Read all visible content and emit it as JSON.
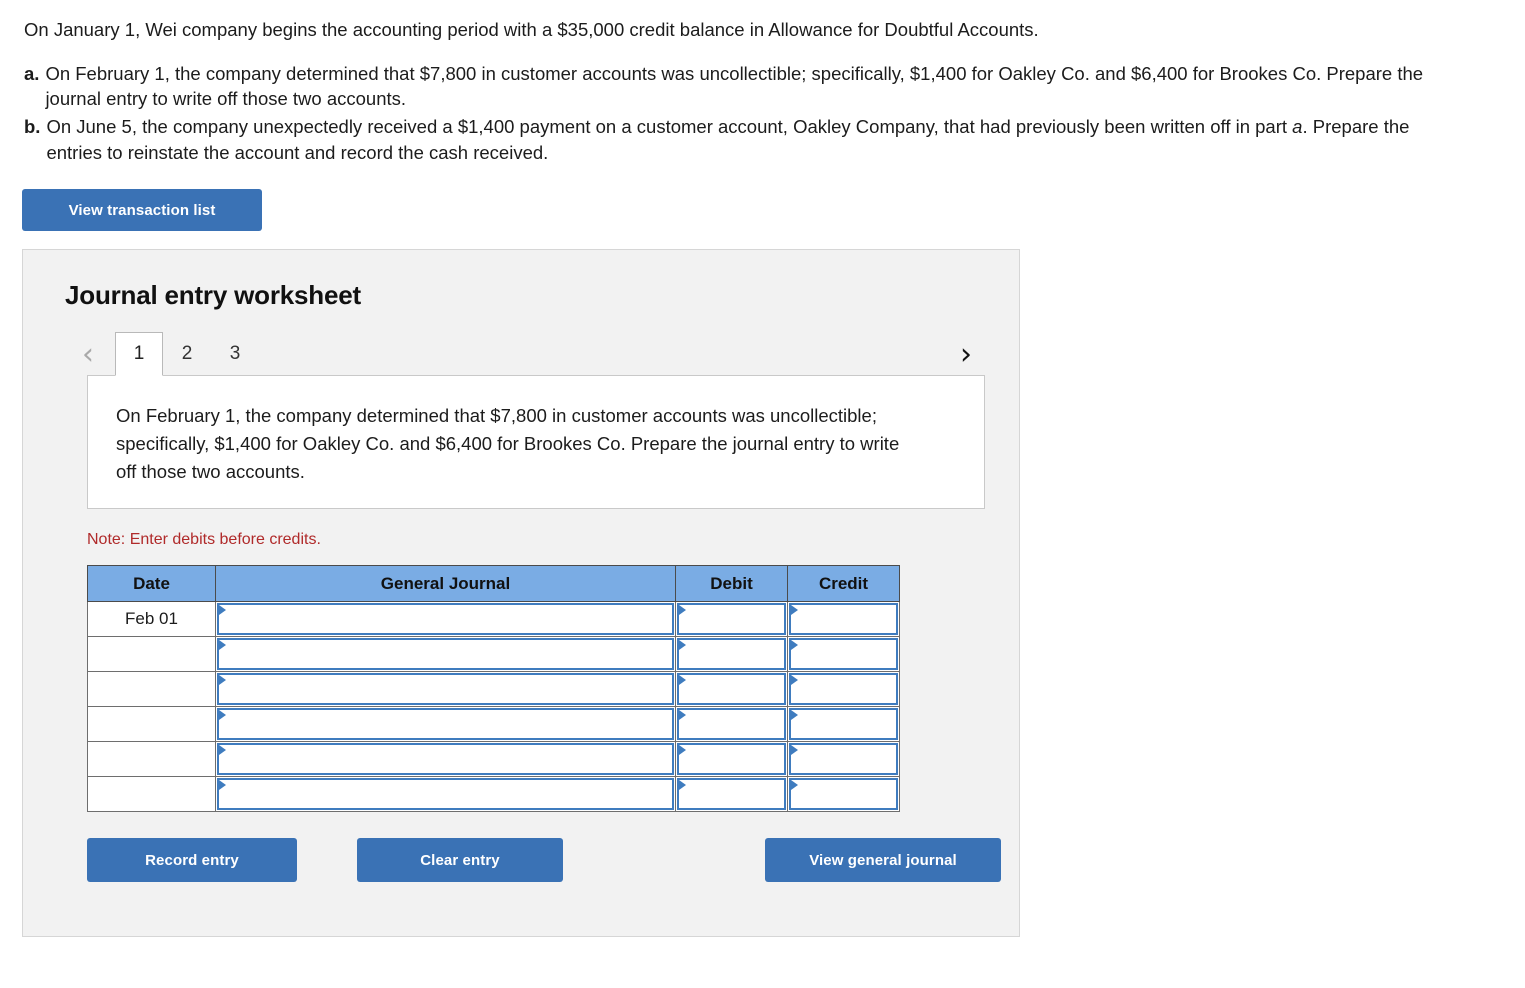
{
  "problem": {
    "intro": "On January 1, Wei company begins the accounting period with a $35,000 credit balance in Allowance for Doubtful Accounts.",
    "requirements": [
      {
        "marker": "a.",
        "text": "On February 1, the company determined that $7,800 in customer accounts was uncollectible; specifically, $1,400 for Oakley Co. and $6,400 for Brookes Co. Prepare the journal entry to write off those two accounts."
      },
      {
        "marker": "b.",
        "text_before": "On June 5, the company unexpectedly received a $1,400 payment on a customer account, Oakley Company, that had previously been written off in part ",
        "text_italic": "a",
        "text_after": ". Prepare the entries to reinstate the account and record the cash received."
      }
    ]
  },
  "toolbar": {
    "view_transaction_list_label": "View transaction list"
  },
  "worksheet": {
    "title": "Journal entry worksheet",
    "nav": {
      "prev_icon": "chevron-left-icon",
      "prev_glyph": "‹",
      "next_icon": "chevron-right-icon",
      "next_glyph": "›"
    },
    "tabs": [
      {
        "label": "1",
        "active": true
      },
      {
        "label": "2",
        "active": false
      },
      {
        "label": "3",
        "active": false
      }
    ],
    "scenario_text": "On February 1, the company determined that $7,800 in customer accounts was uncollectible; specifically, $1,400 for Oakley Co. and $6,400 for Brookes Co. Prepare the journal entry to write off those two accounts.",
    "note": "Note: Enter debits before credits.",
    "table": {
      "headers": [
        "Date",
        "General Journal",
        "Debit",
        "Credit"
      ],
      "rows": [
        {
          "date": "Feb 01",
          "general_journal": "",
          "debit": "",
          "credit": ""
        },
        {
          "date": "",
          "general_journal": "",
          "debit": "",
          "credit": ""
        },
        {
          "date": "",
          "general_journal": "",
          "debit": "",
          "credit": ""
        },
        {
          "date": "",
          "general_journal": "",
          "debit": "",
          "credit": ""
        },
        {
          "date": "",
          "general_journal": "",
          "debit": "",
          "credit": ""
        },
        {
          "date": "",
          "general_journal": "",
          "debit": "",
          "credit": ""
        }
      ]
    },
    "actions": {
      "record_entry_label": "Record entry",
      "clear_entry_label": "Clear entry",
      "view_general_journal_label": "View general journal"
    }
  },
  "colors": {
    "button_blue": "#3a72b5",
    "table_header_blue": "#7aace4",
    "input_border_blue": "#3f7cbf",
    "note_red": "#b02a2a",
    "panel_gray": "#f2f2f2"
  }
}
